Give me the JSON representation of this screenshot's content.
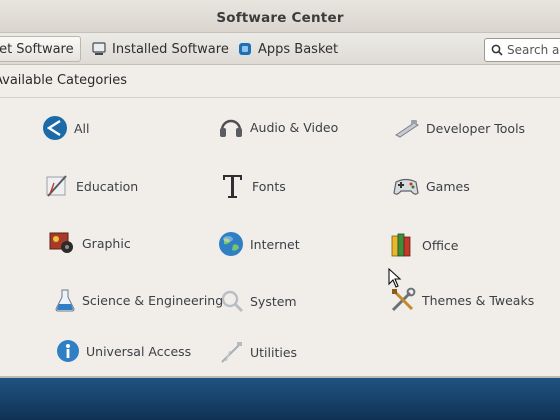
{
  "window": {
    "title": "Software Center"
  },
  "toolbar": {
    "tabs": [
      {
        "label": "Get Software",
        "icon": "get-software-icon",
        "active": true
      },
      {
        "label": "Installed Software",
        "icon": "computer-icon",
        "active": false
      },
      {
        "label": "Apps Basket",
        "icon": "apps-basket-icon",
        "active": false
      }
    ],
    "search": {
      "placeholder": "Search a"
    }
  },
  "main": {
    "heading": "Available Categories",
    "categories": [
      {
        "label": "All",
        "icon": "all-icon"
      },
      {
        "label": "Audio & Video",
        "icon": "headphones-icon"
      },
      {
        "label": "Developer Tools",
        "icon": "developer-tools-icon"
      },
      {
        "label": "Education",
        "icon": "education-icon"
      },
      {
        "label": "Fonts",
        "icon": "fonts-icon"
      },
      {
        "label": "Games",
        "icon": "gamepad-icon"
      },
      {
        "label": "Graphic",
        "icon": "graphic-icon"
      },
      {
        "label": "Internet",
        "icon": "globe-icon"
      },
      {
        "label": "Office",
        "icon": "office-icon"
      },
      {
        "label": "Science & Engineering",
        "icon": "flask-icon"
      },
      {
        "label": "System",
        "icon": "magnifier-icon"
      },
      {
        "label": "Themes & Tweaks",
        "icon": "tools-icon"
      },
      {
        "label": "Universal Access",
        "icon": "universal-access-icon"
      },
      {
        "label": "Utilities",
        "icon": "utilities-icon"
      }
    ]
  },
  "colors": {
    "accent": "#1f6fb3",
    "window_bg": "#f1eee9",
    "desktop": "#1c4f7f"
  }
}
